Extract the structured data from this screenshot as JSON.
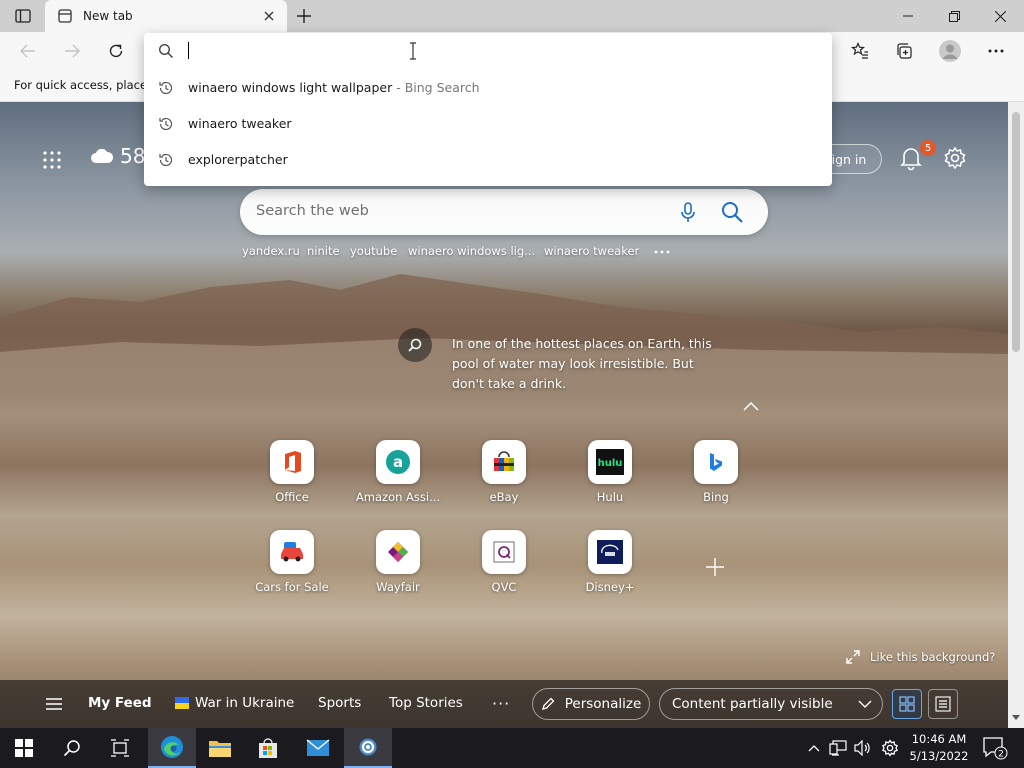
{
  "browser": {
    "tab_title": "New tab",
    "favorites_hint": "For quick access, place y"
  },
  "omnibox": {
    "suggestions": [
      {
        "text": "winaero windows light wallpaper",
        "sub": " - Bing Search"
      },
      {
        "text": "winaero tweaker",
        "sub": ""
      },
      {
        "text": "explorerpatcher",
        "sub": ""
      }
    ]
  },
  "newtab": {
    "weather_temp": "58",
    "signin_label": "Sign in",
    "notification_count": "5",
    "search_placeholder": "Search the web",
    "quick_links": [
      "yandex.ru",
      "ninite",
      "youtube",
      "winaero windows lig...",
      "winaero tweaker"
    ],
    "photo_caption": "In one of the hottest places on Earth, this pool of water may look irresistible. But don't take a drink.",
    "tiles": [
      {
        "label": "Office",
        "icon": "office-icon"
      },
      {
        "label": "Amazon Assi...",
        "icon": "amazon-assistant-icon"
      },
      {
        "label": "eBay",
        "icon": "ebay-icon"
      },
      {
        "label": "Hulu",
        "icon": "hulu-icon"
      },
      {
        "label": "Bing",
        "icon": "bing-icon"
      },
      {
        "label": "Cars for Sale",
        "icon": "cars-icon"
      },
      {
        "label": "Wayfair",
        "icon": "wayfair-icon"
      },
      {
        "label": "QVC",
        "icon": "qvc-icon"
      },
      {
        "label": "Disney+",
        "icon": "disney-icon"
      }
    ],
    "like_background": "Like this background?"
  },
  "feed": {
    "my_feed": "My Feed",
    "war_in_ukraine": "War in Ukraine",
    "sports": "Sports",
    "top_stories": "Top Stories",
    "more": "···",
    "personalize": "Personalize",
    "content_visibility": "Content partially visible"
  },
  "taskbar": {
    "time": "10:46 AM",
    "date": "5/13/2022",
    "notification_count": "2"
  },
  "colors": {
    "accent": "#0078d4",
    "badge": "#e2582a",
    "taskbar": "#1b1b1f"
  }
}
